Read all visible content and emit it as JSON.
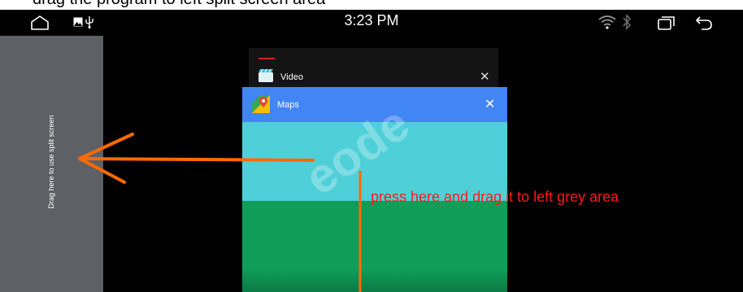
{
  "caption": {
    "text": "drag the program to left split screen area"
  },
  "status_bar": {
    "time": "3:23 PM",
    "icons": [
      "home-icon",
      "gallery-icon",
      "usb-icon",
      "wifi-icon",
      "bluetooth-icon",
      "recents-icon",
      "back-icon"
    ]
  },
  "split_area": {
    "label": "Drag here to use split screen"
  },
  "cards": {
    "video": {
      "title": "Video",
      "close": "✕",
      "icon": "video-clapper-icon"
    },
    "maps": {
      "title": "Maps",
      "close": "✕",
      "icon": "maps-icon"
    }
  },
  "annotation": {
    "instruction": "press here and drag it to left grey area",
    "watermark": "eode",
    "arrow_color": "#ff6a00",
    "text_color": "#ff1a1a"
  }
}
